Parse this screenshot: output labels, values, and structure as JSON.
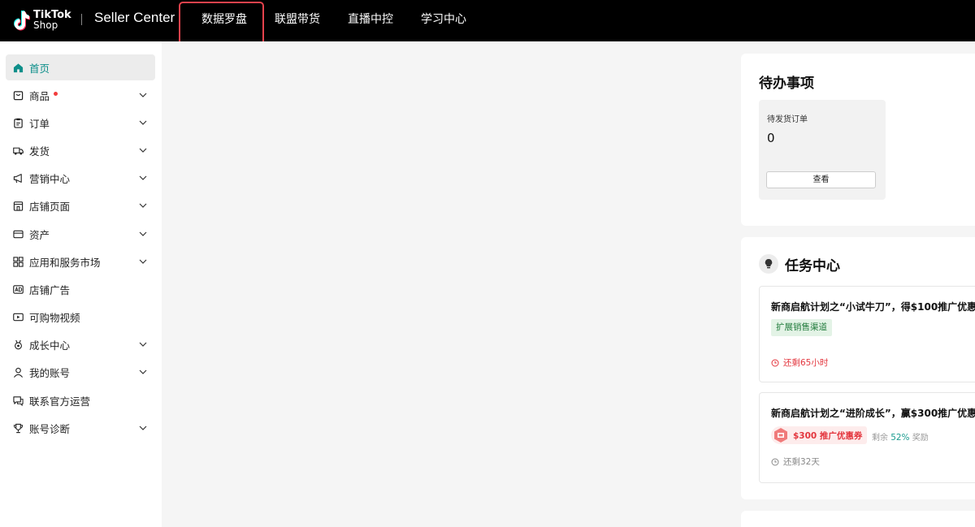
{
  "header": {
    "logo_line1": "TikTok",
    "logo_line2": "Shop",
    "brand": "Seller Center",
    "nav": [
      "数据罗盘",
      "联盟带货",
      "直播中控",
      "学习中心"
    ]
  },
  "sidebar": {
    "items": [
      {
        "label": "首页",
        "icon": "home-icon",
        "active": true
      },
      {
        "label": "商品",
        "icon": "product-icon",
        "chevron": true,
        "dot": true
      },
      {
        "label": "订单",
        "icon": "clipboard-icon",
        "chevron": true
      },
      {
        "label": "发货",
        "icon": "truck-icon",
        "chevron": true
      },
      {
        "label": "营销中心",
        "icon": "megaphone-icon",
        "chevron": true
      },
      {
        "label": "店铺页面",
        "icon": "store-icon",
        "chevron": true
      },
      {
        "label": "资产",
        "icon": "wallet-icon",
        "chevron": true
      },
      {
        "label": "应用和服务市场",
        "icon": "apps-icon",
        "chevron": true
      },
      {
        "label": "店铺广告",
        "icon": "ad-icon"
      },
      {
        "label": "可购物视频",
        "icon": "video-icon"
      },
      {
        "label": "成长中心",
        "icon": "medal-icon",
        "chevron": true
      },
      {
        "label": "我的账号",
        "icon": "user-icon",
        "chevron": true
      },
      {
        "label": "联系官方运营",
        "icon": "chat-icon"
      },
      {
        "label": "账号诊断",
        "icon": "trophy-icon",
        "chevron": true
      }
    ]
  },
  "todo": {
    "title": "待办事项",
    "box_label": "待发货订单",
    "box_count": "0",
    "box_button": "查看"
  },
  "tasks": {
    "title": "任务中心",
    "items": [
      {
        "title": "新商启航计划之“小试牛刀”，得$100推广优惠",
        "tag": "扩展销售渠道",
        "time": "还剩65小时"
      },
      {
        "title": "新商启航计划之“进阶成长”，赢$300推广优惠",
        "coupon": "$300 推广优惠券",
        "remain_prefix": "剩余",
        "remain_pct": "52%",
        "remain_suffix": "奖励",
        "time": "还剩32天"
      }
    ]
  },
  "colors": {
    "accent": "#0e8f8a",
    "highlight": "#e5424c",
    "danger": "#e3353d"
  }
}
